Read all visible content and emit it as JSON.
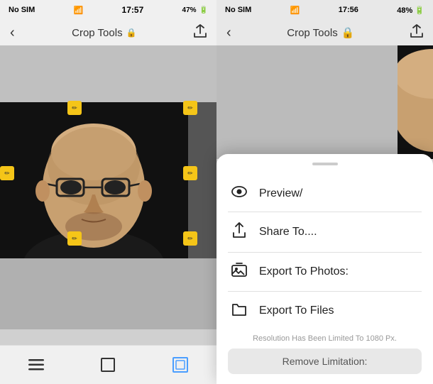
{
  "left": {
    "status": {
      "carrier": "No SIM",
      "time": "17:57",
      "wifi": "▲",
      "battery": "47%"
    },
    "nav": {
      "title": "Crop Tools",
      "back_label": "‹",
      "share_label": "⬆"
    },
    "bottom_bar": {
      "menu_icon": "≡",
      "crop_icon": "⊡",
      "crop_active_icon": "⊞"
    }
  },
  "right": {
    "status": {
      "carrier": "No SIM",
      "time": "17:56",
      "wifi": "▲",
      "battery": "48%"
    },
    "nav": {
      "title": "Crop Tools",
      "back_label": "‹",
      "share_label": "⬆"
    },
    "sheet": {
      "handle": "",
      "items": [
        {
          "id": "preview",
          "icon": "👁",
          "label": "Preview/"
        },
        {
          "id": "share",
          "icon": "⬆",
          "label": "Share To...."
        },
        {
          "id": "export-photos",
          "icon": "🖼",
          "label": "Export To Photos:"
        },
        {
          "id": "export-files",
          "icon": "📁",
          "label": "Export To Files"
        }
      ],
      "resolution_text": "Resolution Has Been Limited To 1080 Px.",
      "remove_btn": "Remove Limitation:"
    }
  }
}
